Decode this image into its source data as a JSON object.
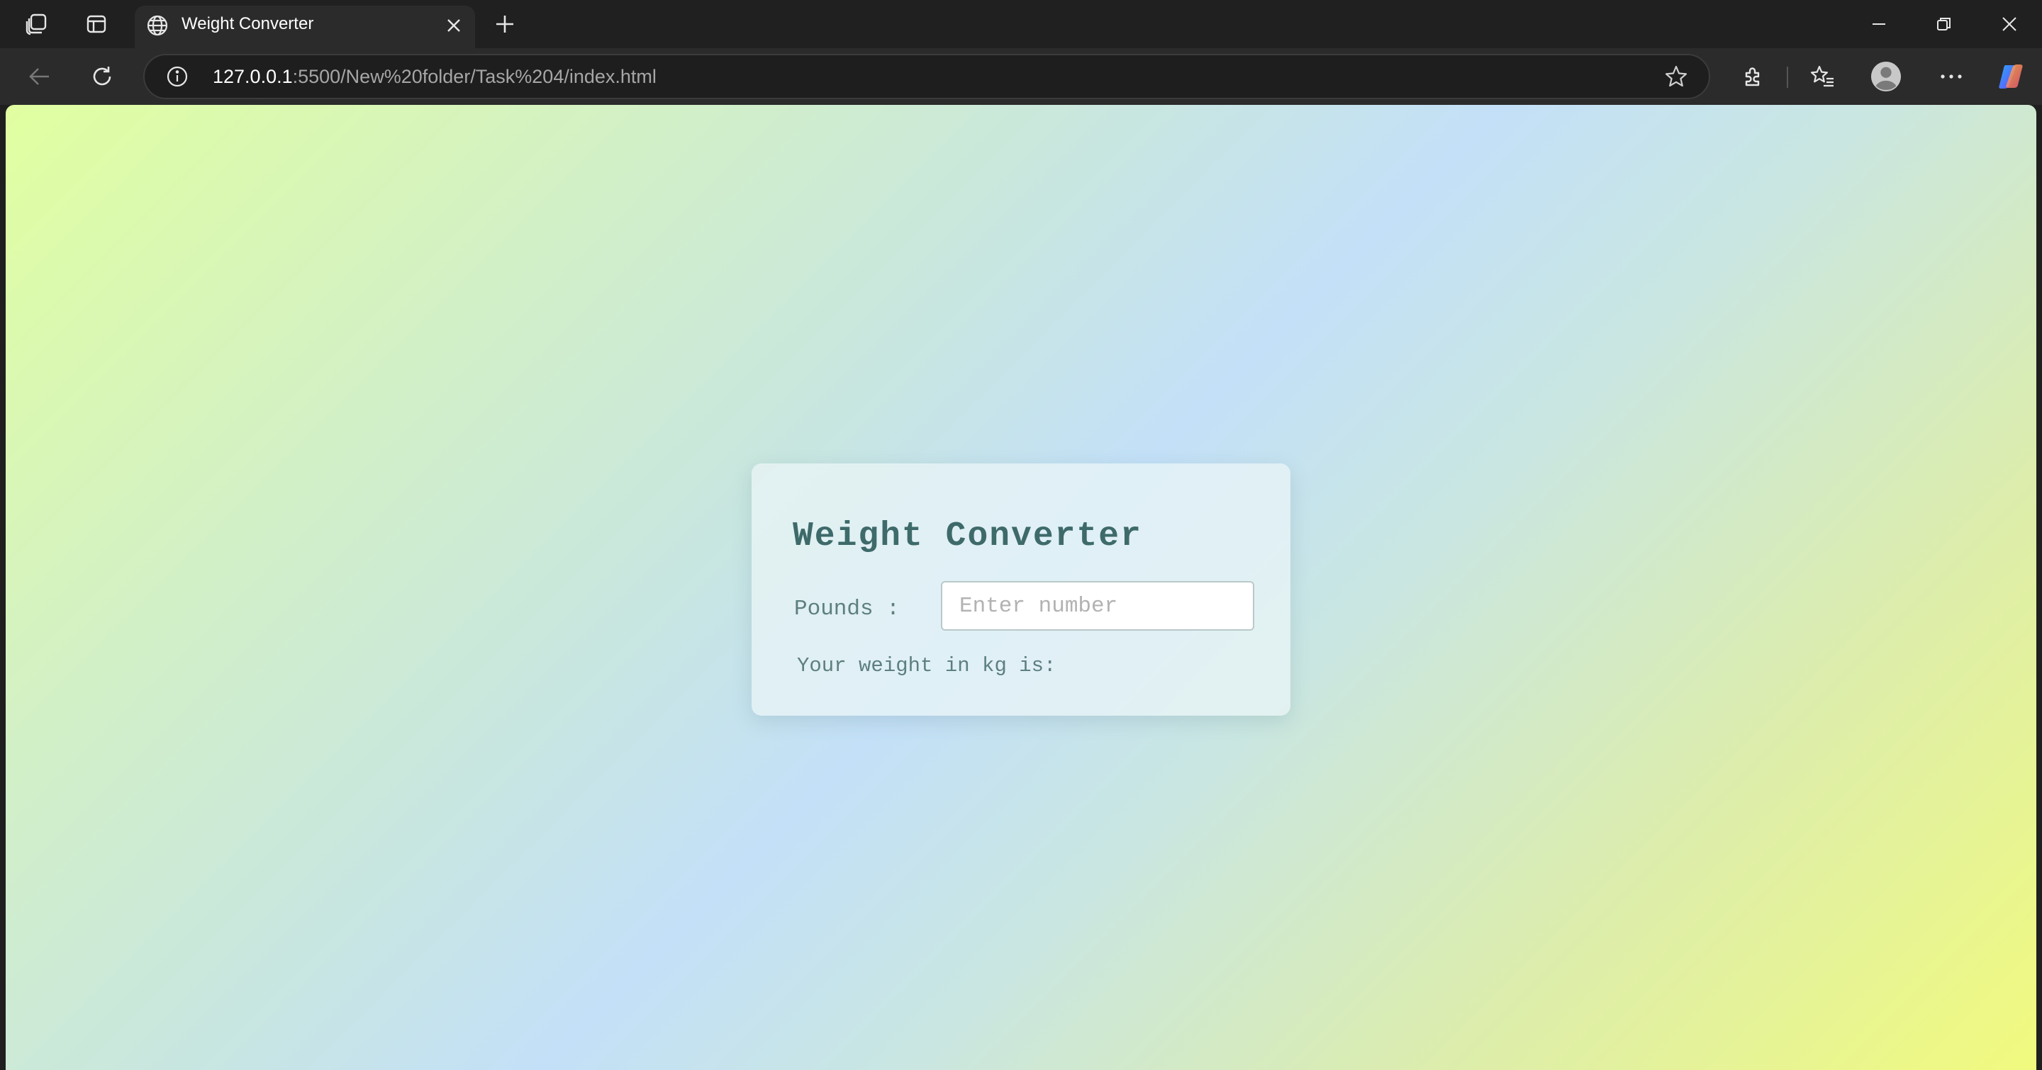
{
  "browser": {
    "tab": {
      "title": "Weight Converter"
    },
    "address_bar": {
      "url_host": "127.0.0.1",
      "url_path": ":5500/New%20folder/Task%204/index.html"
    },
    "icons": {
      "workspaces": "workspaces-icon",
      "tab_actions": "vertical-tabs-icon",
      "favicon": "globe-icon",
      "close_tab": "close-icon",
      "new_tab": "plus-icon",
      "back": "back-arrow-icon",
      "refresh": "refresh-icon",
      "site_info": "info-icon",
      "favorite": "star-icon",
      "extensions": "puzzle-icon",
      "favorites": "favorites-icon",
      "profile": "avatar-icon",
      "more": "more-icon",
      "copilot": "copilot-icon"
    }
  },
  "page": {
    "heading": "Weight Converter",
    "pounds_label": "Pounds :",
    "input_placeholder": "Enter number",
    "input_value": "",
    "result_text": "Your weight in kg is:"
  },
  "colors": {
    "heading": "#3e6a6a",
    "text": "#5d7f7f",
    "gradient_start": "#e1ffa0",
    "gradient_mid": "#c3e0f8",
    "gradient_end": "#f1fa7e"
  }
}
